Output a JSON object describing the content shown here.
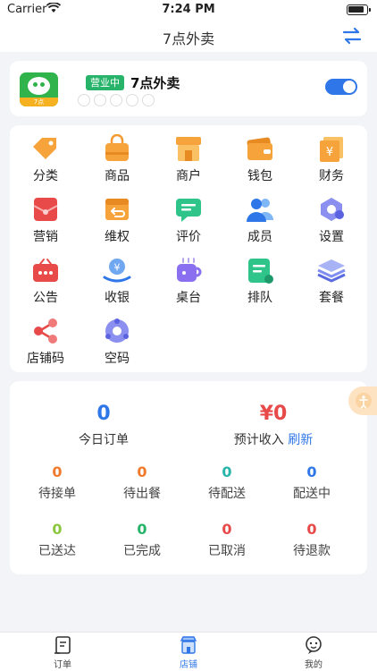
{
  "status_bar": {
    "carrier": "Carrier",
    "time": "7:24 PM"
  },
  "nav": {
    "title": "7点外卖"
  },
  "store": {
    "logo_text": "7点",
    "badge": "营业中",
    "name": "7点外卖",
    "open": true
  },
  "menu": [
    {
      "label": "分类",
      "icon": "tag-icon"
    },
    {
      "label": "商品",
      "icon": "bag-icon"
    },
    {
      "label": "商户",
      "icon": "shop-icon"
    },
    {
      "label": "钱包",
      "icon": "wallet-icon"
    },
    {
      "label": "财务",
      "icon": "finance-icon"
    },
    {
      "label": "营销",
      "icon": "marketing-icon"
    },
    {
      "label": "维权",
      "icon": "return-icon"
    },
    {
      "label": "评价",
      "icon": "comment-icon"
    },
    {
      "label": "成员",
      "icon": "members-icon"
    },
    {
      "label": "设置",
      "icon": "settings-icon"
    },
    {
      "label": "公告",
      "icon": "notice-icon"
    },
    {
      "label": "收银",
      "icon": "cashier-icon"
    },
    {
      "label": "桌台",
      "icon": "table-icon"
    },
    {
      "label": "排队",
      "icon": "queue-icon"
    },
    {
      "label": "套餐",
      "icon": "combo-icon"
    },
    {
      "label": "店铺码",
      "icon": "share-icon"
    },
    {
      "label": "空码",
      "icon": "empty-code-icon"
    }
  ],
  "stats": {
    "today_orders": {
      "value": "0",
      "label": "今日订单"
    },
    "expected_income": {
      "value": "¥0",
      "label": "预计收入",
      "refresh": "刷新"
    },
    "items": [
      {
        "value": "0",
        "label": "待接单",
        "color": "#f0792b"
      },
      {
        "value": "0",
        "label": "待出餐",
        "color": "#f0792b"
      },
      {
        "value": "0",
        "label": "待配送",
        "color": "#26b5a8"
      },
      {
        "value": "0",
        "label": "配送中",
        "color": "#2f77e8"
      },
      {
        "value": "0",
        "label": "已送达",
        "color": "#8cc63f"
      },
      {
        "value": "0",
        "label": "已完成",
        "color": "#27b46a"
      },
      {
        "value": "0",
        "label": "已取消",
        "color": "#e74c3c"
      },
      {
        "value": "0",
        "label": "待退款",
        "color": "#e74c3c"
      }
    ]
  },
  "tabs": [
    {
      "label": "订单",
      "icon": "orders-icon"
    },
    {
      "label": "店铺",
      "icon": "store-icon"
    },
    {
      "label": "我的",
      "icon": "profile-icon"
    }
  ],
  "colors": {
    "accent": "#2f77e8",
    "today_orders": "#2f77e8",
    "income": "#e74c3c"
  }
}
